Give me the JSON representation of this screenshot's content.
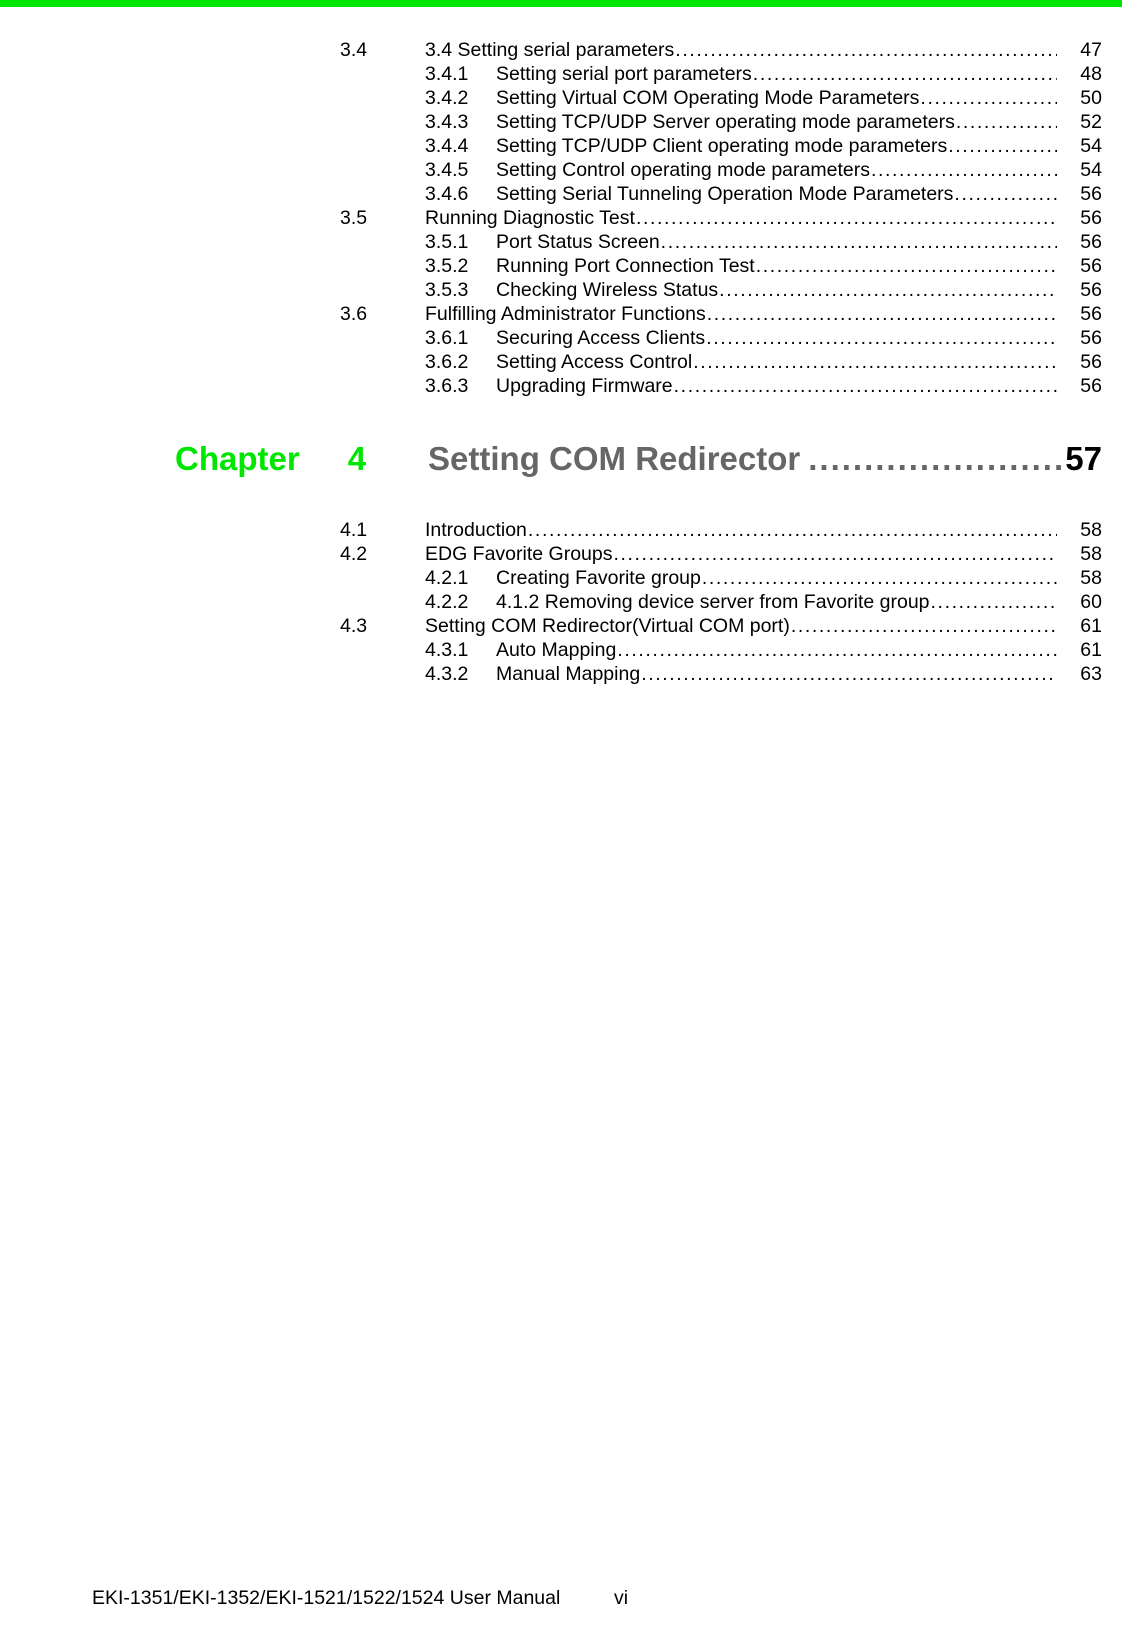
{
  "page": {
    "accent_color": "#00e600",
    "title_color": "#666666",
    "folio": "vi",
    "footer_text": "EKI-1351/EKI-1352/EKI-1521/1522/1524 User Manual"
  },
  "toc_top": {
    "entries": [
      {
        "level": 1,
        "number": "3.4",
        "title": "3.4 Setting serial parameters",
        "page": "47"
      },
      {
        "level": 2,
        "number": "3.4.1",
        "title": "Setting serial port parameters",
        "page": "48"
      },
      {
        "level": 2,
        "number": "3.4.2",
        "title": "Setting Virtual COM Operating Mode Parameters",
        "page": "50"
      },
      {
        "level": 2,
        "number": "3.4.3",
        "title": "Setting TCP/UDP Server operating mode parameters",
        "page": "52"
      },
      {
        "level": 2,
        "number": "3.4.4",
        "title": "Setting TCP/UDP Client operating mode parameters",
        "page": "54"
      },
      {
        "level": 2,
        "number": "3.4.5",
        "title": "Setting Control operating mode parameters",
        "page": "54"
      },
      {
        "level": 2,
        "number": "3.4.6",
        "title": "Setting Serial Tunneling Operation Mode Parameters",
        "page": "56"
      },
      {
        "level": 1,
        "number": "3.5",
        "title": "Running Diagnostic Test",
        "page": "56"
      },
      {
        "level": 2,
        "number": "3.5.1",
        "title": "Port Status Screen",
        "page": "56"
      },
      {
        "level": 2,
        "number": "3.5.2",
        "title": "Running Port Connection Test",
        "page": "56"
      },
      {
        "level": 2,
        "number": "3.5.3",
        "title": "Checking Wireless Status",
        "page": "56"
      },
      {
        "level": 1,
        "number": "3.6",
        "title": "Fulfilling Administrator Functions",
        "page": "56"
      },
      {
        "level": 2,
        "number": "3.6.1",
        "title": "Securing Access Clients ",
        "page": "56"
      },
      {
        "level": 2,
        "number": "3.6.2",
        "title": "Setting Access Control ",
        "page": "56"
      },
      {
        "level": 2,
        "number": "3.6.3",
        "title": "Upgrading Firmware ",
        "page": "56"
      }
    ]
  },
  "chapter": {
    "label": "Chapter",
    "number": "4",
    "title": "Setting COM Redirector",
    "page": "57"
  },
  "toc_bottom": {
    "entries": [
      {
        "level": 1,
        "number": "4.1",
        "title": "Introduction ",
        "page": "58"
      },
      {
        "level": 1,
        "number": "4.2",
        "title": "EDG Favorite Groups ",
        "page": "58"
      },
      {
        "level": 2,
        "number": "4.2.1",
        "title": "Creating Favorite group",
        "page": "58"
      },
      {
        "level": 2,
        "number": "4.2.2",
        "title": "4.1.2 Removing device server from Favorite group",
        "page": "60"
      },
      {
        "level": 1,
        "number": "4.3",
        "title": "Setting COM Redirector(Virtual COM port)",
        "page": "61"
      },
      {
        "level": 2,
        "number": "4.3.1",
        "title": "Auto Mapping",
        "page": "61"
      },
      {
        "level": 2,
        "number": "4.3.2",
        "title": "Manual Mapping ",
        "page": "63"
      }
    ]
  }
}
